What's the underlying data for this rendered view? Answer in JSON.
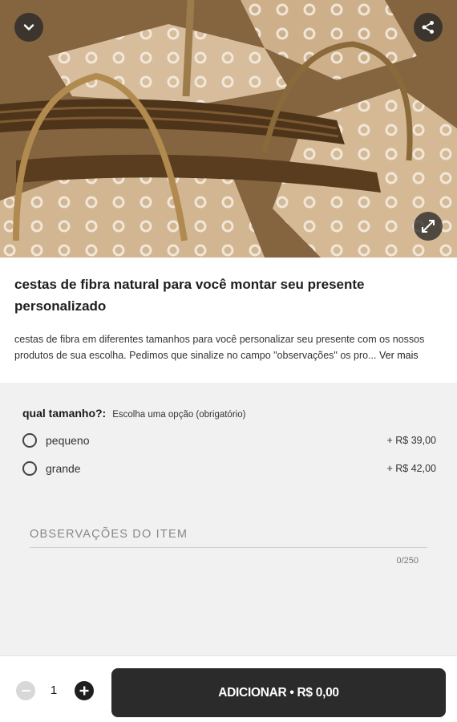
{
  "product": {
    "title": "cestas de fibra natural para você montar seu presente personalizado",
    "description": "cestas de fibra em diferentes tamanhos para você personalizar seu presente com os nossos produtos de sua escolha. Pedimos que sinalize no campo \"observações\" os pro...",
    "see_more_label": "Ver mais"
  },
  "options": {
    "title": "qual tamanho?:",
    "subtitle": "Escolha uma opção (obrigatório)",
    "items": [
      {
        "label": "pequeno",
        "price": "+ R$ 39,00",
        "selected": false
      },
      {
        "label": "grande",
        "price": "+ R$ 42,00",
        "selected": false
      }
    ]
  },
  "notes": {
    "label": "OBSERVAÇÕES DO ITEM",
    "counter": "0/250"
  },
  "cart": {
    "quantity": "1",
    "add_label": "ADICIONAR • R$ 0,00"
  },
  "icons": {
    "collapse": "chevron-down-icon",
    "share": "share-icon",
    "expand": "expand-icon",
    "minus": "minus-icon",
    "plus": "plus-icon"
  },
  "colors": {
    "add_button": "#2b2b2b",
    "options_background": "#f1f1f1"
  }
}
